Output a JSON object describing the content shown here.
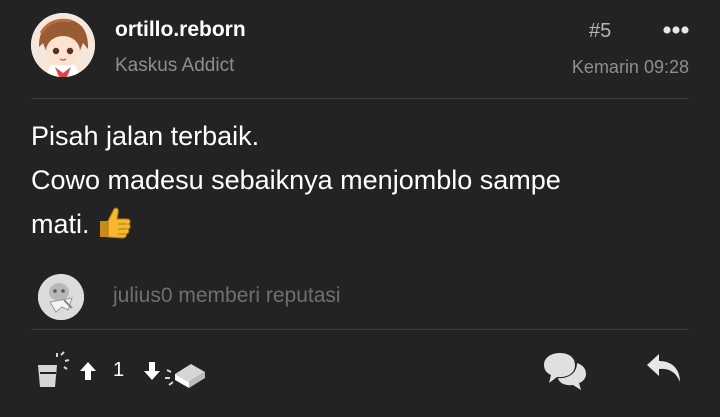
{
  "post": {
    "username": "ortillo.reborn",
    "user_title": "Kaskus Addict",
    "post_number": "#5",
    "timestamp": "Kemarin 09:28",
    "body_lines": [
      "Pisah jalan terbaik.",
      "Cowo madesu sebaiknya menjomblo sampe",
      "mati."
    ],
    "emoji": "thumbs-up-icon"
  },
  "reputation": {
    "text": "julius0 memberi reputasi"
  },
  "actions": {
    "vote_count": "1",
    "icons": [
      "cendol-icon",
      "upvote-arrow-icon",
      "downvote-arrow-icon",
      "bata-icon",
      "comment-icon",
      "reply-icon",
      "more-icon"
    ]
  },
  "colors": {
    "background": "#232323",
    "primary_text": "#ffffff",
    "secondary_text": "#8e8e8e",
    "reputation_text": "#6f6f6f",
    "divider": "#3c3c3c"
  }
}
